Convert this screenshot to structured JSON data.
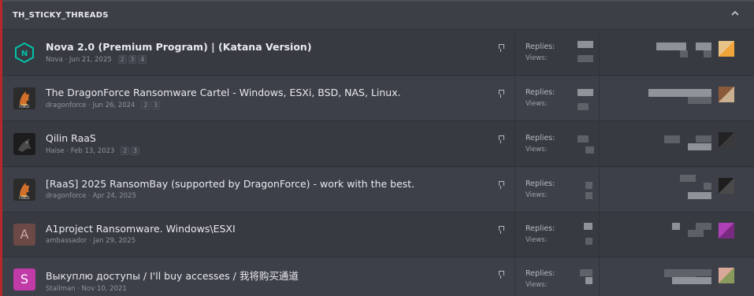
{
  "header": {
    "title": "TH_STICKY_THREADS",
    "collapse_icon": "chevron-up-icon"
  },
  "labels": {
    "replies": "Replies:",
    "views": "Views:"
  },
  "threads": [
    {
      "title": "Nova 2.0 (Premium Program) | (Katana Version)",
      "author": "Nova",
      "date": "Jun 21, 2025",
      "pages": [
        "2",
        "3",
        "4"
      ],
      "avatar_type": "hex-logo",
      "avatar_color": "#00c2a8",
      "thumb_colors": [
        "#e8c48a",
        "#f0a43a"
      ]
    },
    {
      "title": "The DragonForce Ransomware Cartel - Windows, ESXi, BSD, NAS, Linux.",
      "author": "dragonforce",
      "date": "Jun 26, 2024",
      "pages": [
        "2",
        "3"
      ],
      "avatar_type": "dragon-logo",
      "avatar_color": "#d0702a",
      "thumb_colors": [
        "#8a5a3a",
        "#c8b090"
      ]
    },
    {
      "title": "Qilin RaaS",
      "author": "Haise",
      "date": "Feb 13, 2023",
      "pages": [
        "2",
        "3"
      ],
      "avatar_type": "dark-image",
      "avatar_color": "#1c1c1c",
      "thumb_colors": [
        "#222222",
        "#3a3a3a"
      ]
    },
    {
      "title": "[RaaS] 2025 RansomBay (supported by DragonForce) - work with the best.",
      "author": "dragonforce",
      "date": "Apr 24, 2025",
      "pages": [],
      "avatar_type": "dragon-logo",
      "avatar_color": "#d0702a",
      "thumb_colors": [
        "#1e1e1e",
        "#4a4a4a"
      ]
    },
    {
      "title": "A1project Ransomware. Windows\\ESXI",
      "author": "ambassador",
      "date": "Jan 29, 2025",
      "pages": [],
      "avatar_type": "letter",
      "avatar_letter": "A",
      "avatar_color": "#6b4a46",
      "thumb_colors": [
        "#b040b8",
        "#7a2a80"
      ]
    },
    {
      "title": "Выкуплю доступы / I'll buy accesses / 我将购买通道",
      "author": "Stallman",
      "date": "Nov 10, 2021",
      "pages": [],
      "avatar_type": "letter",
      "avatar_letter": "S",
      "avatar_color": "#c03aa8",
      "thumb_colors": [
        "#d8a898",
        "#8a9a5a"
      ]
    }
  ]
}
